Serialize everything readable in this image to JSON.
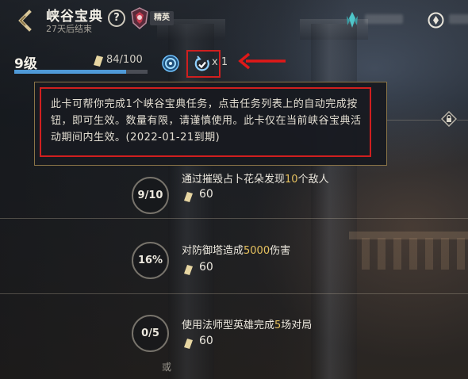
{
  "header": {
    "title": "峡谷宝典",
    "subtitle": "27天后结束",
    "help_label": "?",
    "rank_label": "精英"
  },
  "level_row": {
    "level_label": "9级",
    "xp_text": "84/100",
    "xp_progress": 0.84,
    "card_count_text": "x 1"
  },
  "tooltip": {
    "text": "此卡可帮你完成1个峡谷宝典任务，点击任务列表上的自动完成按钮，即可生效。数量有限，请谨慎使用。此卡仅在当前峡谷宝典活动期间内生效。(2022-01-21到期)"
  },
  "tasks": [
    {
      "progress": "9/10",
      "desc_pre": "通过摧毁占卜花朵发现",
      "desc_num": "10",
      "desc_post": "个敌人",
      "reward": "60"
    },
    {
      "progress": "16%",
      "desc_pre": "对防御塔造成",
      "desc_num": "5000",
      "desc_post": "伤害",
      "reward": "60"
    },
    {
      "progress": "0/5",
      "desc_pre": "使用法师型英雄完成",
      "desc_num": "5",
      "desc_post": "场对局",
      "reward": "60"
    }
  ],
  "or_label": "或",
  "colors": {
    "accent_gold": "#e7c25f",
    "progress_blue": "#4f9ad8",
    "highlight_red": "#d01f1f",
    "tooltip_border": "#8a7448"
  },
  "icons": {
    "back": "back-arrow-icon",
    "help": "question-icon",
    "rank": "rank-emblem-icon",
    "gem": "crystal-icon",
    "coin": "coin-icon",
    "xp": "xp-token-icon",
    "buff": "buff-icon",
    "card": "auto-complete-card-icon",
    "arrow": "red-arrow-icon",
    "lock": "lock-icon"
  }
}
